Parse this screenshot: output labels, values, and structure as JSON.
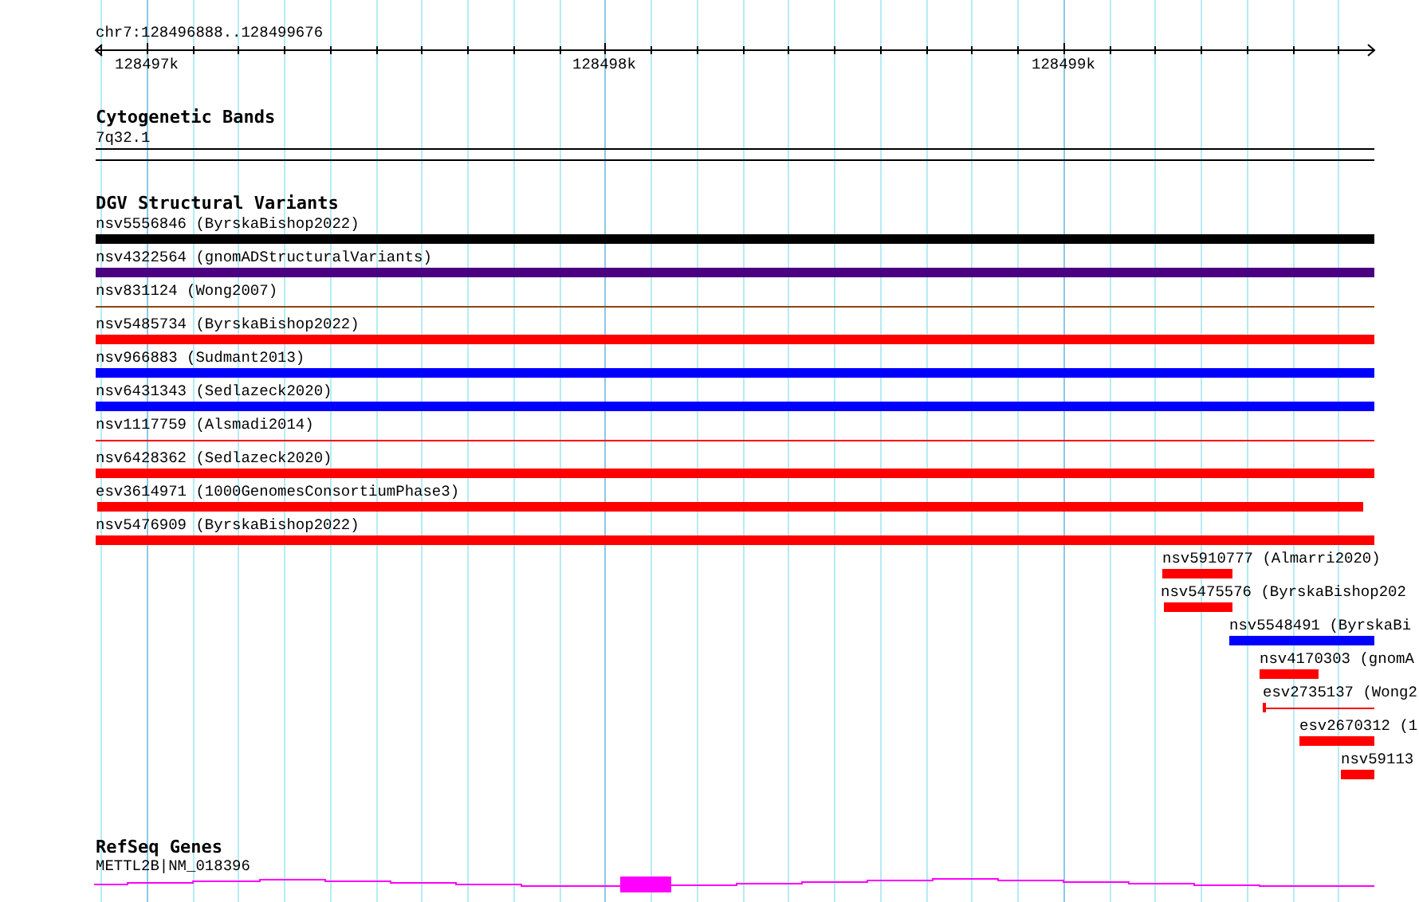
{
  "ruler": {
    "range": "chr7:128496888..128499676",
    "ticks": [
      "128497k",
      "128498k",
      "128499k"
    ]
  },
  "tracks": [
    {
      "kind": "bands",
      "title": "Cytogenetic Bands",
      "features": [
        {
          "label": "7q32.1"
        }
      ]
    },
    {
      "kind": "variants",
      "title": "DGV Structural Variants",
      "features": [
        {
          "label": "nsv5556846 (ByrskaBishop2022)",
          "color": "#000000",
          "kind": "bar"
        },
        {
          "label": "nsv4322564 (gnomADStructuralVariants)",
          "color": "#4b0082",
          "kind": "bar"
        },
        {
          "label": "nsv831124 (Wong2007)",
          "color": "#8b4513",
          "kind": "line"
        },
        {
          "label": "nsv5485734 (ByrskaBishop2022)",
          "color": "#ff0000",
          "kind": "bar"
        },
        {
          "label": "nsv966883 (Sudmant2013)",
          "color": "#0000ff",
          "kind": "bar"
        },
        {
          "label": "nsv6431343 (Sedlazeck2020)",
          "color": "#0000ff",
          "kind": "bar"
        },
        {
          "label": "nsv1117759 (Alsmadi2014)",
          "color": "#ff0000",
          "kind": "line"
        },
        {
          "label": "nsv6428362 (Sedlazeck2020)",
          "color": "#ff0000",
          "kind": "bar"
        },
        {
          "label": "esv3614971 (1000GenomesConsortiumPhase3)",
          "color": "#ff0000",
          "kind": "bar"
        },
        {
          "label": "nsv5476909 (ByrskaBishop2022)",
          "color": "#ff0000",
          "kind": "bar"
        },
        {
          "label": "nsv5910777 (Almarri2020)",
          "color": "#ff0000",
          "kind": "bar"
        },
        {
          "label": "nsv5475576 (ByrskaBishop202",
          "color": "#ff0000",
          "kind": "bar"
        },
        {
          "label": "nsv5548491 (ByrskaBi",
          "color": "#0000ff",
          "kind": "bar"
        },
        {
          "label": "nsv4170303 (gnomA",
          "color": "#ff0000",
          "kind": "bar"
        },
        {
          "label": "esv2735137 (Wong2",
          "color": "#ff0000",
          "kind": "line"
        },
        {
          "label": "esv2670312 (1",
          "color": "#ff0000",
          "kind": "bar"
        },
        {
          "label": "nsv59113",
          "color": "#ff0000",
          "kind": "bar"
        }
      ]
    },
    {
      "kind": "genes",
      "title": "RefSeq Genes",
      "features": [
        {
          "label": "METTL2B|NM_018396",
          "color": "#ff00ff"
        }
      ]
    }
  ]
}
